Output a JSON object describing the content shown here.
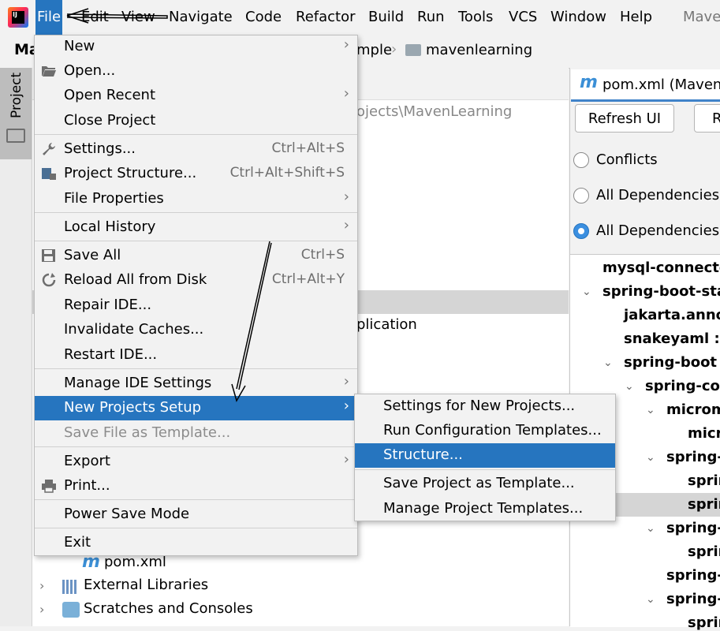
{
  "menubar": {
    "items": [
      "File",
      "Edit",
      "View",
      "Navigate",
      "Code",
      "Refactor",
      "Build",
      "Run",
      "Tools",
      "VCS",
      "Window",
      "Help"
    ],
    "window_title": "Mave",
    "logo_text": "IJ"
  },
  "navbar": {
    "project": "Ma",
    "crumb1": "mple",
    "crumb2": "mavenlearning"
  },
  "tool_window": {
    "project_tab": "Project"
  },
  "project_tree": {
    "path": "ojects\\MavenLearning",
    "app_item": "plication",
    "pom": "pom.xml",
    "external_libraries": "External Libraries",
    "scratches": "Scratches and Consoles"
  },
  "file_menu": {
    "items": [
      {
        "label": "New",
        "shortcut": "",
        "submenu": true
      },
      {
        "label": "Open...",
        "shortcut": "",
        "submenu": false
      },
      {
        "label": "Open Recent",
        "shortcut": "",
        "submenu": true
      },
      {
        "label": "Close Project",
        "shortcut": "",
        "submenu": false
      },
      {
        "label": "Settings...",
        "shortcut": "Ctrl+Alt+S",
        "submenu": false
      },
      {
        "label": "Project Structure...",
        "shortcut": "Ctrl+Alt+Shift+S",
        "submenu": false
      },
      {
        "label": "File Properties",
        "shortcut": "",
        "submenu": true
      },
      {
        "label": "Local History",
        "shortcut": "",
        "submenu": true
      },
      {
        "label": "Save All",
        "shortcut": "Ctrl+S",
        "submenu": false
      },
      {
        "label": "Reload All from Disk",
        "shortcut": "Ctrl+Alt+Y",
        "submenu": false
      },
      {
        "label": "Repair IDE...",
        "shortcut": "",
        "submenu": false
      },
      {
        "label": "Invalidate Caches...",
        "shortcut": "",
        "submenu": false
      },
      {
        "label": "Restart IDE...",
        "shortcut": "",
        "submenu": false
      },
      {
        "label": "Manage IDE Settings",
        "shortcut": "",
        "submenu": true
      },
      {
        "label": "New Projects Setup",
        "shortcut": "",
        "submenu": true,
        "highlighted": true
      },
      {
        "label": "Save File as Template...",
        "shortcut": "",
        "submenu": false,
        "disabled": true
      },
      {
        "label": "Export",
        "shortcut": "",
        "submenu": true
      },
      {
        "label": "Print...",
        "shortcut": "",
        "submenu": false
      },
      {
        "label": "Power Save Mode",
        "shortcut": "",
        "submenu": false
      },
      {
        "label": "Exit",
        "shortcut": "",
        "submenu": false
      }
    ]
  },
  "submenu": {
    "items": [
      {
        "label": "Settings for New Projects..."
      },
      {
        "label": "Run Configuration Templates..."
      },
      {
        "label": "Structure...",
        "highlighted": true
      },
      {
        "label": "Save Project as Template..."
      },
      {
        "label": "Manage Project Templates..."
      }
    ]
  },
  "maven_panel": {
    "tab": "pom.xml (Mavenl",
    "refresh": "Refresh UI",
    "r_button": "R",
    "radios": [
      {
        "label": "Conflicts",
        "checked": false
      },
      {
        "label": "All Dependencies a",
        "checked": false
      },
      {
        "label": "All Dependencies a",
        "checked": true
      }
    ],
    "deps": [
      "mysql-connector",
      "spring-boot-star",
      "jakarta.annota",
      "snakeyaml : 2.",
      "spring-boot :",
      "spring-cor",
      "microm",
      "micr",
      "spring-a",
      "sprin",
      "sprin",
      "spring-b",
      "sprin",
      "spring-c",
      "spring-c",
      "sprin"
    ]
  },
  "colors": {
    "highlight": "#2675bf",
    "menu_bg": "#f2f2f2"
  }
}
